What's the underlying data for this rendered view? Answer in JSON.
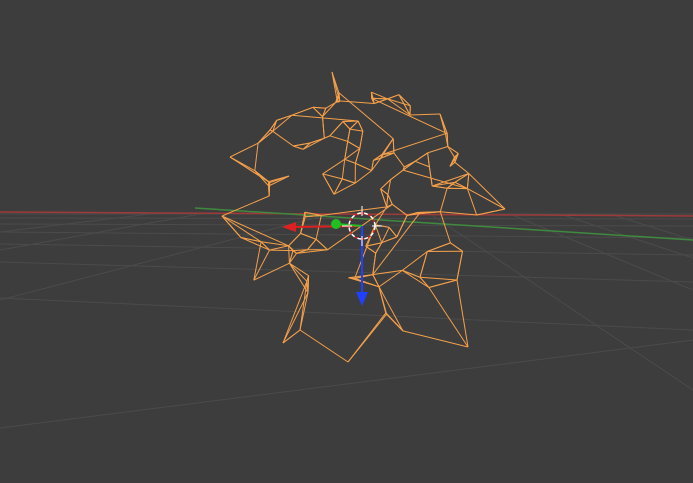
{
  "viewport": {
    "background_color": "#3d3d3d",
    "grid_color": "#4a4a4a",
    "x_axis_color": "#9e3a3a",
    "y_axis_color": "#3f8a3f",
    "selection_color": "#f5a04a",
    "gizmo_x_color": "#e02020",
    "gizmo_y_color": "#20c020",
    "gizmo_z_color": "#2040ff",
    "cursor_icon": "3d-cursor-icon",
    "object_mode": "wireframe",
    "object_selected": true
  }
}
